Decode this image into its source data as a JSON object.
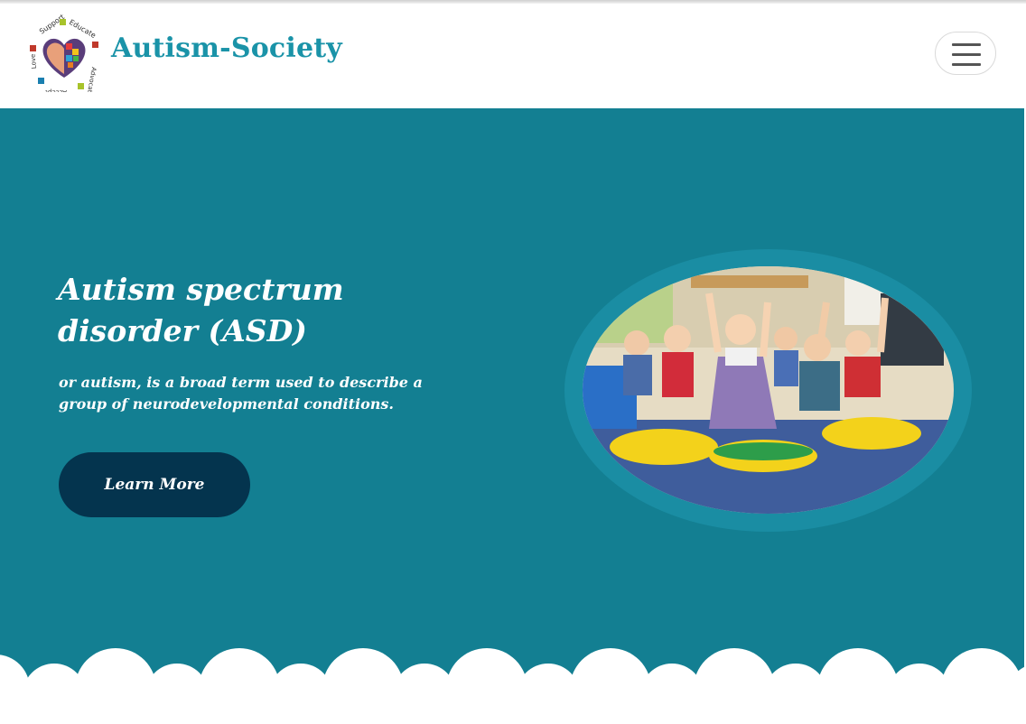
{
  "brand": {
    "name": "Autism-Society",
    "logo_words": [
      "Support",
      "Educate",
      "Advocate",
      "Accept",
      "Love"
    ]
  },
  "header": {
    "menu_icon": "hamburger-icon"
  },
  "hero": {
    "title": "Autism spectrum disorder (ASD)",
    "subtitle": "or autism, is a broad term used to describe a group of neurodevelopmental conditions.",
    "cta_label": "Learn More",
    "image": "photo of cheerful children raising hands in a classroom"
  },
  "colors": {
    "brand_text": "#1a93a8",
    "hero_bg": "#137f92",
    "button_bg": "#04344e",
    "ring": "#1a8da3"
  }
}
